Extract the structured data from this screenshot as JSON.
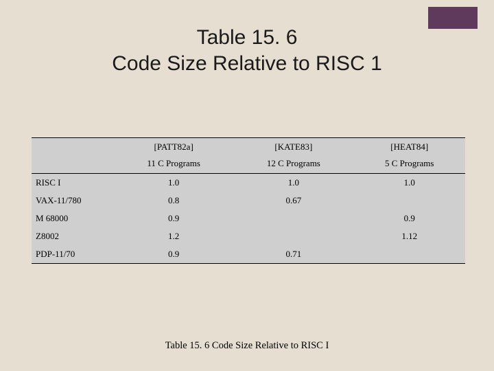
{
  "corner_color": "#5f3a5c",
  "title": {
    "line1": "Table 15. 6",
    "line2": "Code Size Relative to RISC 1"
  },
  "table": {
    "header_row1": [
      "",
      "[PATT82a]",
      "[KATE83]",
      "[HEAT84]"
    ],
    "header_row2": [
      "",
      "11 C Programs",
      "12 C Programs",
      "5 C Programs"
    ],
    "rows": [
      {
        "label": "RISC I",
        "c1": "1.0",
        "c2": "1.0",
        "c3": "1.0"
      },
      {
        "label": "VAX-11/780",
        "c1": "0.8",
        "c2": "0.67",
        "c3": ""
      },
      {
        "label": "M 68000",
        "c1": "0.9",
        "c2": "",
        "c3": "0.9"
      },
      {
        "label": "Z8002",
        "c1": "1.2",
        "c2": "",
        "c3": "1.12"
      },
      {
        "label": "PDP-11/70",
        "c1": "0.9",
        "c2": "0.71",
        "c3": ""
      }
    ]
  },
  "caption": "Table 15. 6  Code Size Relative to RISC I",
  "chart_data": {
    "type": "table",
    "title": "Table 15.6 Code Size Relative to RISC 1",
    "columns": [
      {
        "ref": "[PATT82a]",
        "desc": "11 C Programs"
      },
      {
        "ref": "[KATE83]",
        "desc": "12 C Programs"
      },
      {
        "ref": "[HEAT84]",
        "desc": "5 C Programs"
      }
    ],
    "rows": [
      {
        "machine": "RISC I",
        "PATT82a": 1.0,
        "KATE83": 1.0,
        "HEAT84": 1.0
      },
      {
        "machine": "VAX-11/780",
        "PATT82a": 0.8,
        "KATE83": 0.67,
        "HEAT84": null
      },
      {
        "machine": "M 68000",
        "PATT82a": 0.9,
        "KATE83": null,
        "HEAT84": 0.9
      },
      {
        "machine": "Z8002",
        "PATT82a": 1.2,
        "KATE83": null,
        "HEAT84": 1.12
      },
      {
        "machine": "PDP-11/70",
        "PATT82a": 0.9,
        "KATE83": 0.71,
        "HEAT84": null
      }
    ]
  }
}
